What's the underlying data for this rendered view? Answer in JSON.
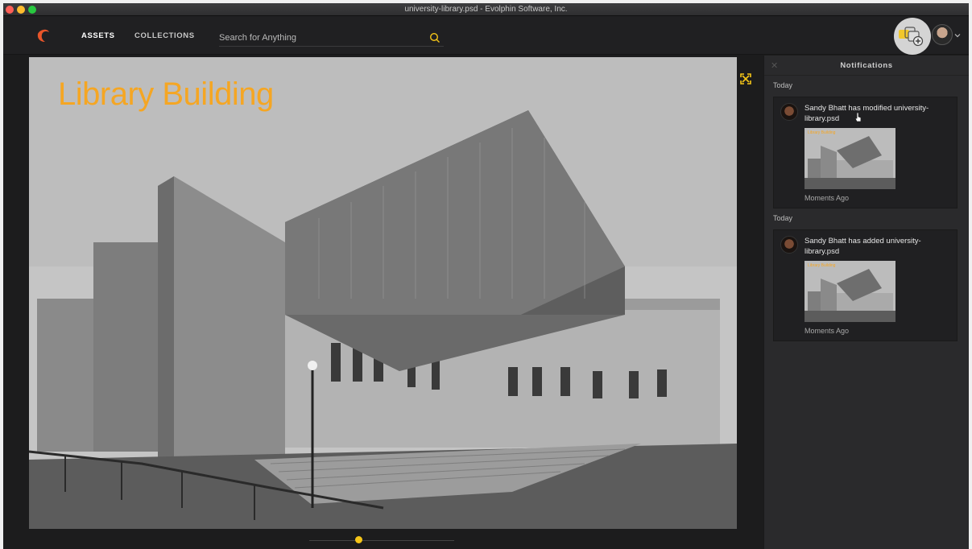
{
  "window": {
    "title": "university-library.psd - Evolphin Software, Inc."
  },
  "header": {
    "logo_icon": "evolphin-logo-icon",
    "nav": [
      {
        "label": "ASSETS",
        "active": true
      },
      {
        "label": "COLLECTIONS",
        "active": false
      }
    ],
    "search": {
      "placeholder": "Search for Anything",
      "value": "",
      "icon": "search-icon"
    },
    "notifications_icon": "notifications-add-icon",
    "avatar_icon": "user-avatar",
    "menu_icon": "chevron-down-icon"
  },
  "viewer": {
    "image_headline": "Library Building",
    "expand_icon": "expand-icon",
    "accent": "#f5a623"
  },
  "notifications": {
    "title": "Notifications",
    "close_icon": "close-icon",
    "items": [
      {
        "day": "Today",
        "message": "Sandy Bhatt has modified university-library.psd",
        "thumb_title": "Library Building",
        "time": "Moments Ago"
      },
      {
        "day": "Today",
        "message": "Sandy Bhatt has added university-library.psd",
        "thumb_title": "Library Building",
        "time": "Moments Ago"
      }
    ]
  },
  "colors": {
    "background": "#1c1c1d",
    "panel": "#2a2a2c",
    "scrubber_dot": "#f5c518"
  }
}
